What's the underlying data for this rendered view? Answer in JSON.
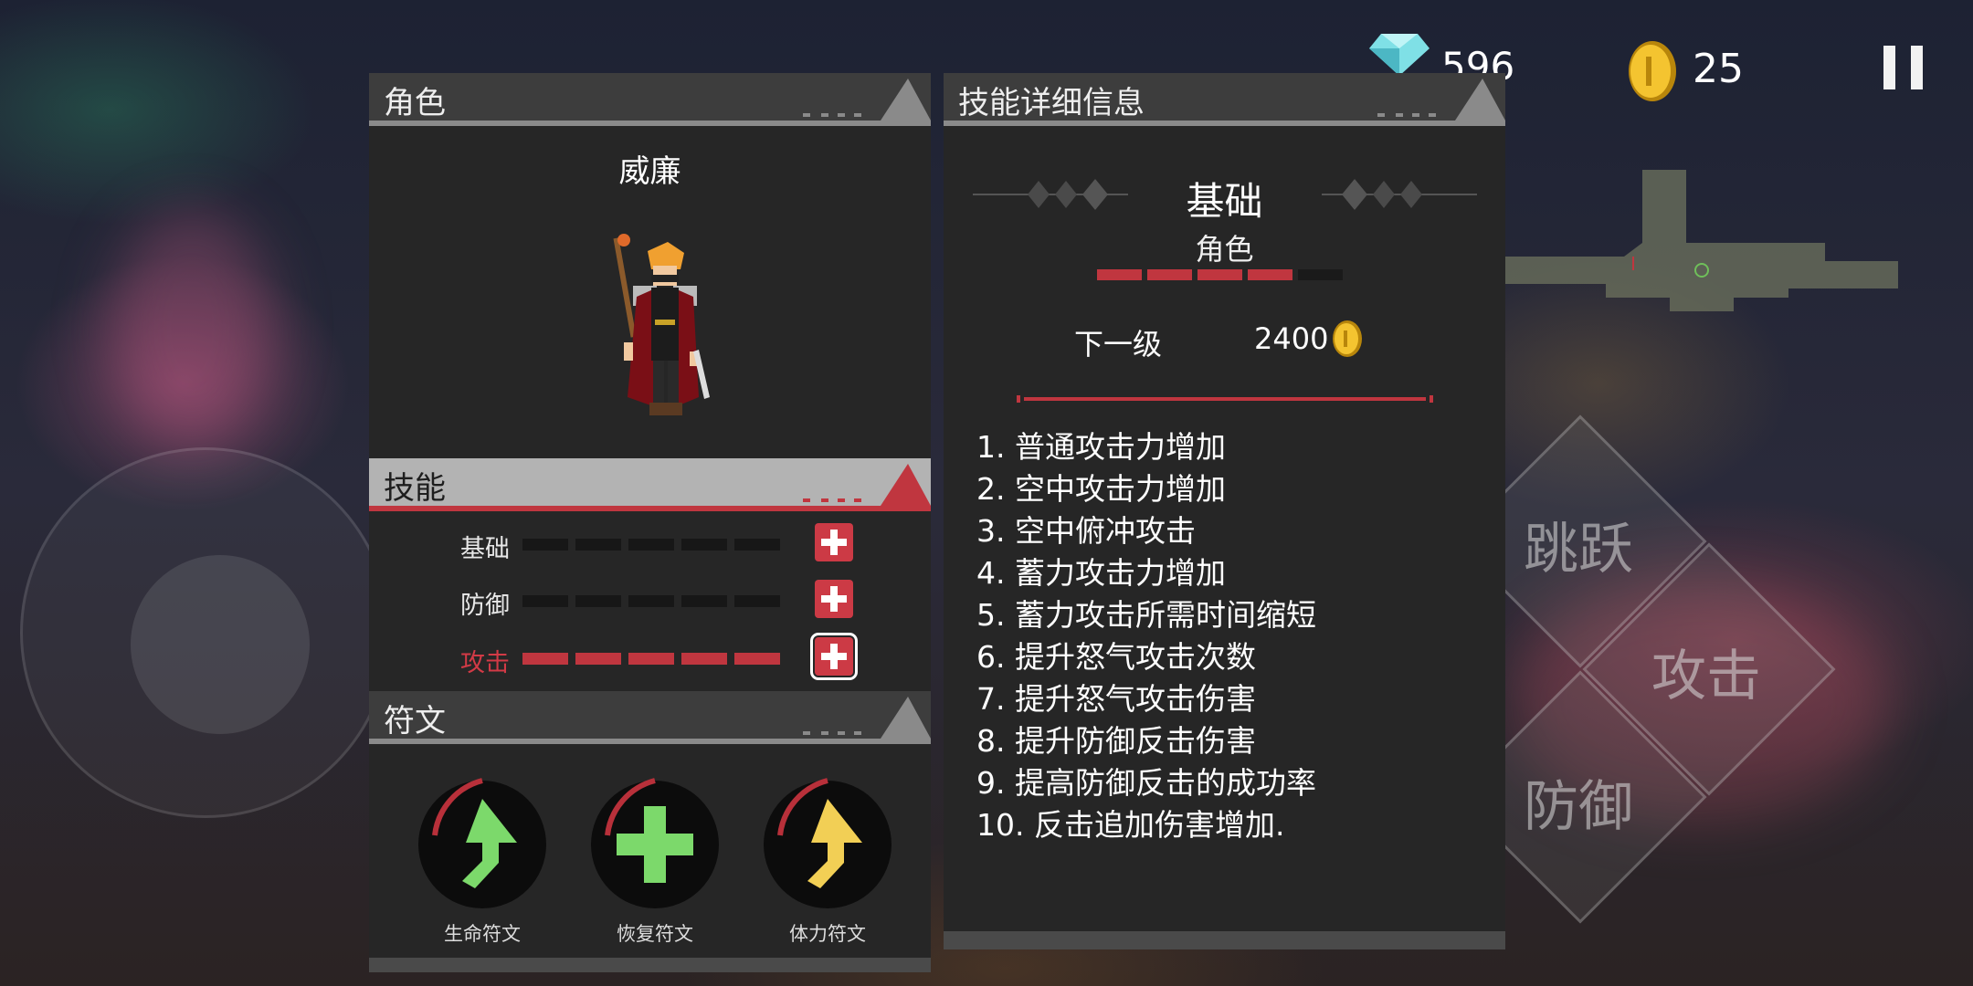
{
  "hud": {
    "gems": "596",
    "coins": "25",
    "icons": {
      "gem": "diamond-icon",
      "coin": "gold-coin-icon",
      "pause": "pause-icon"
    }
  },
  "controls": {
    "jump": "跳跃",
    "attack": "攻击",
    "defend": "防御"
  },
  "character_panel": {
    "title": "角色",
    "name": "威廉"
  },
  "skills_panel": {
    "title": "技能",
    "skills": [
      {
        "name": "基础",
        "level": 0,
        "max": 5
      },
      {
        "name": "防御",
        "level": 0,
        "max": 5
      },
      {
        "name": "攻击",
        "level": 5,
        "max": 5,
        "selected": true
      }
    ]
  },
  "runes_panel": {
    "title": "符文",
    "runes": [
      {
        "label": "生命符文",
        "icon": "arrow-up-green-icon"
      },
      {
        "label": "恢复符文",
        "icon": "plus-green-icon"
      },
      {
        "label": "体力符文",
        "icon": "arrow-up-yellow-icon"
      }
    ]
  },
  "detail_panel": {
    "title": "技能详细信息",
    "category": "基础",
    "subtitle": "角色",
    "level": 4,
    "max_level": 5,
    "next_label": "下一级",
    "next_cost": "2400",
    "items": [
      "1. 普通攻击力增加",
      "2. 空中攻击力增加",
      "3. 空中俯冲攻击",
      "4. 蓄力攻击力增加",
      "5. 蓄力攻击所需时间缩短",
      "6. 提升怒气攻击次数",
      "7. 提升怒气攻击伤害",
      "8. 提升防御反击伤害",
      "9. 提高防御反击的成功率",
      "10. 反击追加伤害增加."
    ]
  },
  "colors": {
    "accent_red": "#c0363f",
    "panel_bg": "#262626",
    "header_bg": "#3d3d3d"
  }
}
